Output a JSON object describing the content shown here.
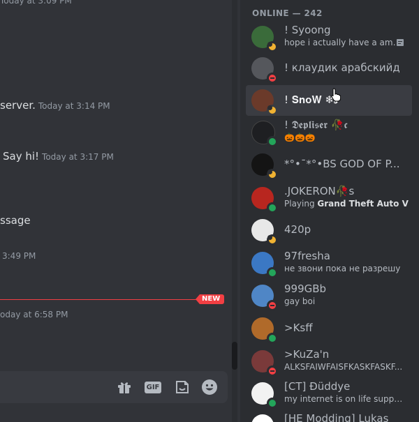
{
  "chat": {
    "messages": [
      {
        "text": "",
        "timestamp": "Today at 3:09 PM"
      },
      {
        "text": "server.",
        "timestamp": "Today at 3:14 PM"
      },
      {
        "text": "Say hi!",
        "timestamp": "Today at 3:17 PM"
      },
      {
        "text": "ssage",
        "timestamp": ""
      },
      {
        "text": "",
        "timestamp": "3:49 PM"
      },
      {
        "text": "",
        "timestamp": "oday at 6:58 PM"
      }
    ],
    "new_badge": "NEW",
    "composer": {
      "gift_icon": "gift-icon",
      "gif_label": "GIF",
      "sticker_icon": "sticker-icon",
      "emoji_icon": "emoji-icon"
    }
  },
  "members": {
    "header": "ONLINE — 242",
    "list": [
      {
        "name": "! Syoong",
        "sub": "hope i actually have a ama...",
        "status": "idle",
        "avatar_color": "#3a6b3a"
      },
      {
        "name": "! клаудик арабскийд",
        "sub": "",
        "status": "dnd",
        "avatar_color": "#55575c"
      },
      {
        "name": "! 𝐒𝐧𝐨𝐖 ❄𝓼",
        "sub": "",
        "status": "idle",
        "avatar_color": "#6b3a2a"
      },
      {
        "name": "! 𝕯𝖊𝖕𝖑𝖎𝖘𝖊𝖗 🥀𝖈",
        "sub": "🎃🎃🎃",
        "status": "online",
        "avatar_color": "#1e1f22"
      },
      {
        "name": "*°•¯*°•BS GOD OF P...",
        "sub": "",
        "status": "idle",
        "avatar_color": "#141414"
      },
      {
        "name": ".JOKERON🥀s",
        "sub_prefix": "Playing ",
        "sub_bold": "Grand Theft Auto V",
        "status": "online",
        "avatar_color": "#b8261f"
      },
      {
        "name": "420p",
        "sub": "",
        "status": "idle",
        "avatar_color": "#e8e8e8"
      },
      {
        "name": "97fresha",
        "sub": "не звони пока не разрешу",
        "status": "online",
        "avatar_color": "#3b78c4"
      },
      {
        "name": "999GBb",
        "sub": "gay boi",
        "status": "dnd",
        "avatar_color": "#4f86c6"
      },
      {
        "name": ">Ksff",
        "sub": "",
        "status": "online",
        "avatar_color": "#b06a2a"
      },
      {
        "name": ">KuZa'n",
        "sub": "ALKSFAIWFAISFKASKFASKF...",
        "status": "dnd",
        "avatar_color": "#7a3a3a"
      },
      {
        "name": "[CT] Ðüddye",
        "sub": "my internet is on life support...",
        "status": "online",
        "avatar_color": "#f2f2f2"
      },
      {
        "name": "[HE Modding] Lukas",
        "sub": "",
        "status": "online",
        "avatar_color": "#ffffff"
      }
    ]
  }
}
